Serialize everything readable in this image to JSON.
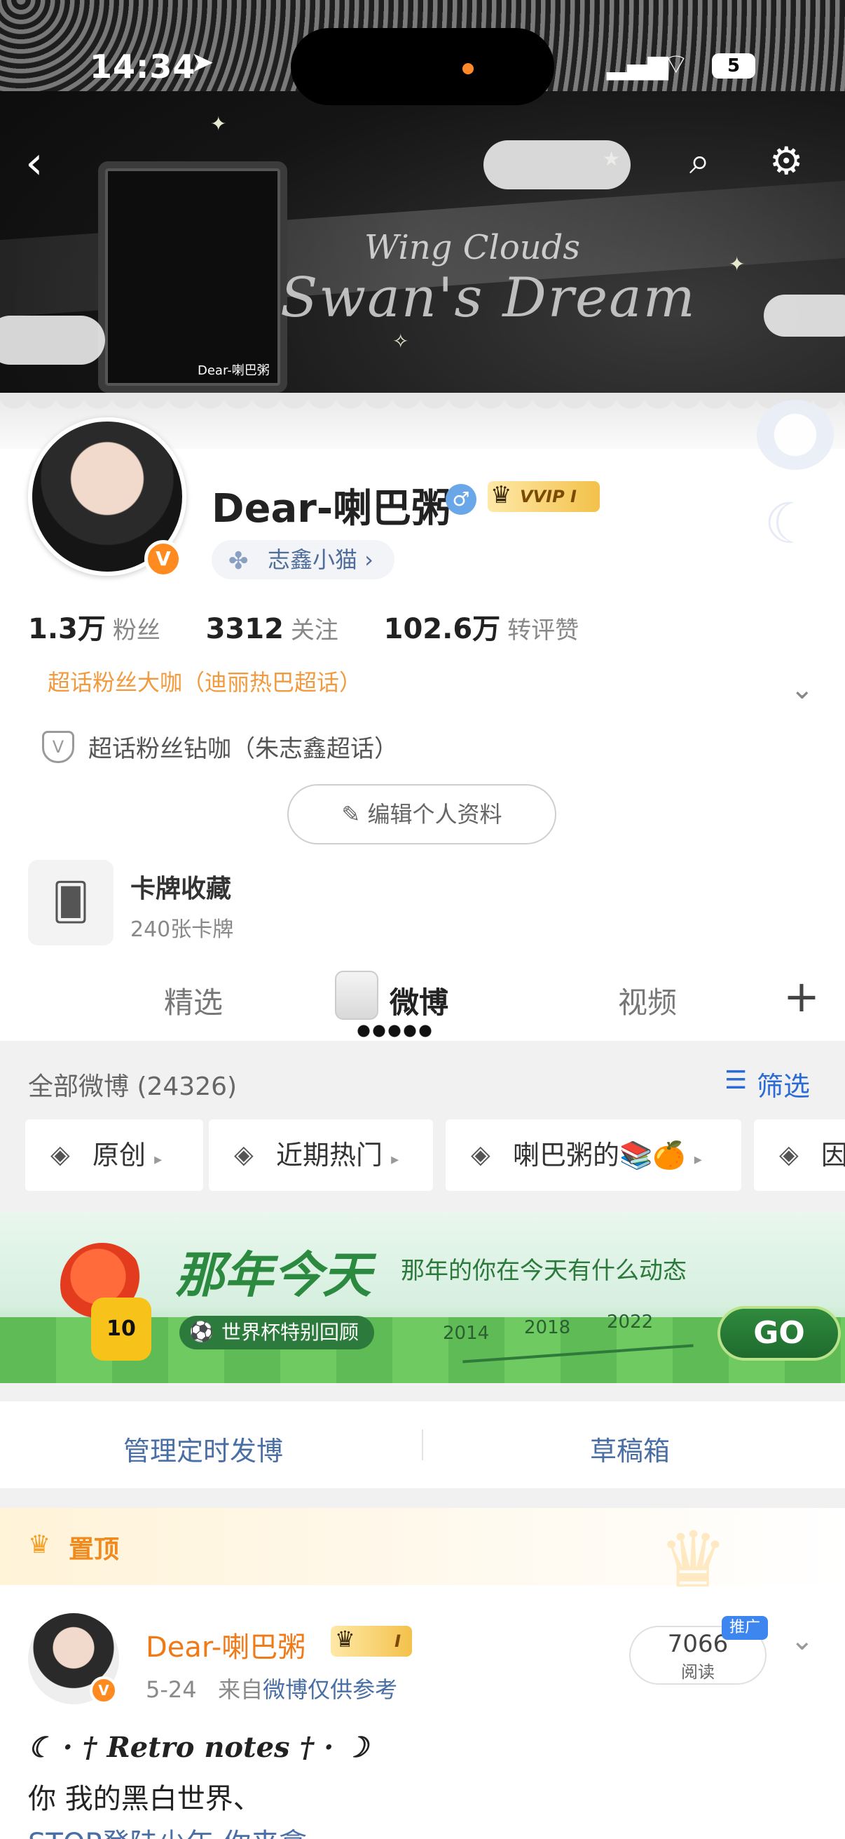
{
  "status_bar": {
    "time": "14:34",
    "battery": "5"
  },
  "banner": {
    "title_line1": "Wing Clouds",
    "title_line2": "Swan's Dream",
    "caption": "Dear-喇巴粥"
  },
  "profile": {
    "name": "Dear-喇巴粥",
    "vip_badge": "VVIP Ⅰ",
    "tag": "志鑫小猫 ›",
    "stats": [
      {
        "value": "1.3万",
        "label": "粉丝"
      },
      {
        "value": "3312",
        "label": "关注"
      },
      {
        "value": "102.6万",
        "label": "转评赞"
      }
    ],
    "super_topic_1": "超话粉丝大咖（迪丽热巴超话）",
    "super_topic_2": "超话粉丝钻咖（朱志鑫超话）",
    "edit_button": "编辑个人资料"
  },
  "card_collection": {
    "title": "卡牌收藏",
    "subtitle": "240张卡牌"
  },
  "tabs": [
    {
      "label": "精选"
    },
    {
      "label": "微博"
    },
    {
      "label": "视频"
    }
  ],
  "feed_header": {
    "count_label": "全部微博 (24326)",
    "filter_label": "筛选"
  },
  "chips": [
    {
      "label": "原创"
    },
    {
      "label": "近期热门"
    },
    {
      "label": "喇巴粥的📚🍊"
    },
    {
      "label": "因"
    }
  ],
  "memory_banner": {
    "title": "那年今天",
    "subtitle": "那年的你在今天有什么动态",
    "world_cup": "世界杯特别回顾",
    "years": [
      "2014",
      "2018",
      "2022"
    ],
    "go": "GO",
    "jersey_number": "10"
  },
  "manage": {
    "scheduled": "管理定时发博",
    "drafts": "草稿箱"
  },
  "pinned": {
    "label": "置顶",
    "author": "Dear-喇巴粥",
    "vip_badge": "Ⅰ",
    "date": "5-24",
    "source_prefix": "来自",
    "source": "微博仅供参考",
    "reads_value": "7066",
    "reads_label": "阅读",
    "promo": "推广",
    "line1": "☾ · † Retro notes † · ☽",
    "line2": "你 我的黑白世界、",
    "line3": "STOP登陆少年 你来拿"
  },
  "icons": [
    "back-icon",
    "search-icon",
    "settings-icon",
    "location-arrow-icon",
    "signal-icon",
    "wifi-icon",
    "battery-icon"
  ]
}
